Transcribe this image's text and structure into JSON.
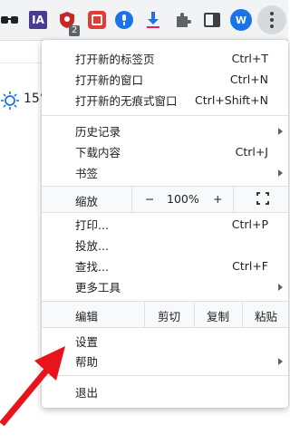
{
  "toolbar": {
    "ia_label": "IA",
    "shield_badge": "2",
    "avatar_letter": "W"
  },
  "page": {
    "temperature": "15°"
  },
  "menu": {
    "new_tab": {
      "label": "打开新的标签页",
      "shortcut": "Ctrl+T"
    },
    "new_window": {
      "label": "打开新的窗口",
      "shortcut": "Ctrl+N"
    },
    "new_incognito": {
      "label": "打开新的无痕式窗口",
      "shortcut": "Ctrl+Shift+N"
    },
    "history": {
      "label": "历史记录"
    },
    "downloads": {
      "label": "下载内容",
      "shortcut": "Ctrl+J"
    },
    "bookmarks": {
      "label": "书签"
    },
    "zoom": {
      "label": "缩放",
      "minus": "−",
      "value": "100%",
      "plus": "+"
    },
    "print": {
      "label": "打印...",
      "shortcut": "Ctrl+P"
    },
    "cast": {
      "label": "投放..."
    },
    "find": {
      "label": "查找...",
      "shortcut": "Ctrl+F"
    },
    "more_tools": {
      "label": "更多工具"
    },
    "edit": {
      "label": "编辑",
      "cut": "剪切",
      "copy": "复制",
      "paste": "粘贴"
    },
    "settings": {
      "label": "设置"
    },
    "help": {
      "label": "帮助"
    },
    "exit": {
      "label": "退出"
    }
  },
  "colors": {
    "arrow": "#e8141b",
    "accent": "#1a73e8"
  }
}
